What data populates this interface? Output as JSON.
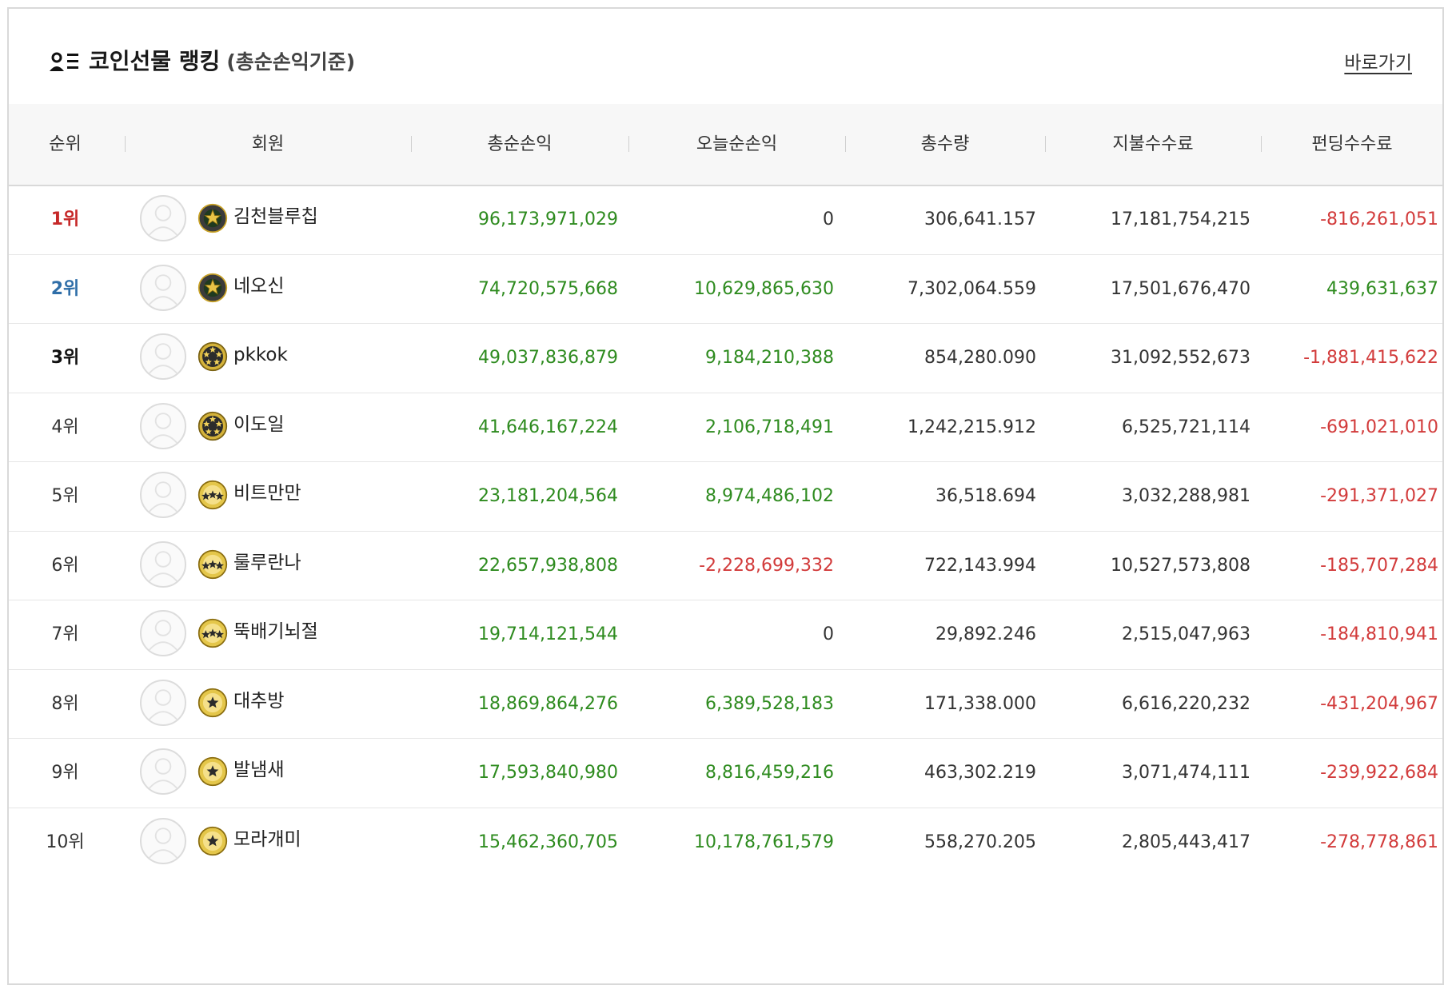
{
  "header": {
    "title": "코인선물 랭킹",
    "subtitle": "(총순손익기준)",
    "link_label": "바로가기",
    "icon": "member-list-icon"
  },
  "columns": [
    "순위",
    "회원",
    "총순손익",
    "오늘순손익",
    "총수량",
    "지불수수료",
    "펀딩수수료"
  ],
  "colors": {
    "positive": "#2e8b1f",
    "negative": "#d23b3b",
    "rank1": "#c62828",
    "rank2": "#2f6ea8",
    "border": "#d9d9d9",
    "header_bg": "#f7f7f7"
  },
  "rows": [
    {
      "rank": "1위",
      "badge": "gold-laurel-badge",
      "name": "김천블루칩",
      "total": "96,173,971,029",
      "today": "0",
      "qty": "306,641.157",
      "paid": "17,181,754,215",
      "funding": "-816,261,051"
    },
    {
      "rank": "2위",
      "badge": "gold-laurel-badge",
      "name": "네오신",
      "total": "74,720,575,668",
      "today": "10,629,865,630",
      "qty": "7,302,064.559",
      "paid": "17,501,676,470",
      "funding": "439,631,637"
    },
    {
      "rank": "3위",
      "badge": "five-star-badge",
      "name": "pkkok",
      "total": "49,037,836,879",
      "today": "9,184,210,388",
      "qty": "854,280.090",
      "paid": "31,092,552,673",
      "funding": "-1,881,415,622"
    },
    {
      "rank": "4위",
      "badge": "five-star-badge",
      "name": "이도일",
      "total": "41,646,167,224",
      "today": "2,106,718,491",
      "qty": "1,242,215.912",
      "paid": "6,525,721,114",
      "funding": "-691,021,010"
    },
    {
      "rank": "5위",
      "badge": "three-star-badge",
      "name": "비트만만",
      "total": "23,181,204,564",
      "today": "8,974,486,102",
      "qty": "36,518.694",
      "paid": "3,032,288,981",
      "funding": "-291,371,027"
    },
    {
      "rank": "6위",
      "badge": "three-star-badge",
      "name": "룰루란나",
      "total": "22,657,938,808",
      "today": "-2,228,699,332",
      "qty": "722,143.994",
      "paid": "10,527,573,808",
      "funding": "-185,707,284"
    },
    {
      "rank": "7위",
      "badge": "three-star-badge",
      "name": "뚝배기뇌절",
      "total": "19,714,121,544",
      "today": "0",
      "qty": "29,892.246",
      "paid": "2,515,047,963",
      "funding": "-184,810,941"
    },
    {
      "rank": "8위",
      "badge": "one-star-badge",
      "name": "대추방",
      "total": "18,869,864,276",
      "today": "6,389,528,183",
      "qty": "171,338.000",
      "paid": "6,616,220,232",
      "funding": "-431,204,967"
    },
    {
      "rank": "9위",
      "badge": "one-star-badge",
      "name": "발냄새",
      "total": "17,593,840,980",
      "today": "8,816,459,216",
      "qty": "463,302.219",
      "paid": "3,071,474,111",
      "funding": "-239,922,684"
    },
    {
      "rank": "10위",
      "badge": "one-star-badge",
      "name": "모라개미",
      "total": "15,462,360,705",
      "today": "10,178,761,579",
      "qty": "558,270.205",
      "paid": "2,805,443,417",
      "funding": "-278,778,861"
    }
  ]
}
